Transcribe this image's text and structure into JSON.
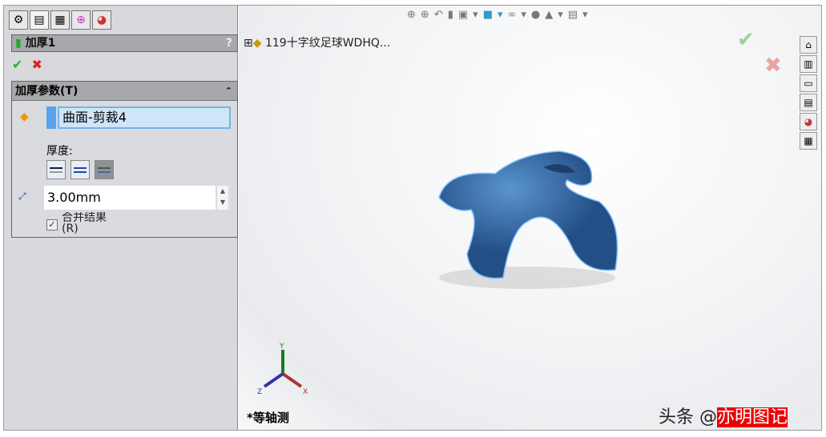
{
  "property_manager": {
    "tabs": [
      "feature-manager",
      "property-manager",
      "configuration-manager",
      "dimxpert-manager",
      "display-manager"
    ],
    "title": "加厚1",
    "help": "?",
    "ok": "✔",
    "cancel": "✖",
    "group_title": "加厚参数(T)",
    "collapse": "⌃",
    "selected_face": "曲面-剪裁4",
    "thickness_label": "厚度:",
    "thickness_value": "3.00mm",
    "merge_label": "合并结果(R)",
    "merge_checked": true
  },
  "viewport": {
    "tree_root": "119十字纹足球WDHQ...",
    "view_name": "*等轴测",
    "axes": {
      "x": "X",
      "y": "Y",
      "z": "Z"
    },
    "watermark_prefix": "头条 @",
    "watermark_name": "亦明图记",
    "part_color": "#3a78b8"
  }
}
